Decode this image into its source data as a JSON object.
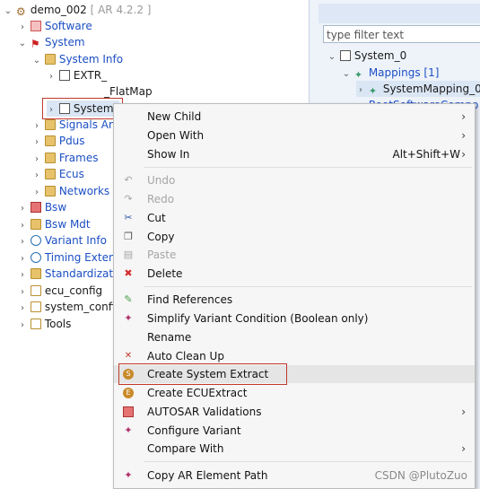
{
  "tree": {
    "root_label": "demo_002",
    "root_version": "[ AR 4.2.2 ]",
    "software": "Software",
    "system": "System",
    "system_info": "System Info",
    "extr": "EXTR_",
    "flatmap": "_FlatMap",
    "system_sel": "System_",
    "signals": "Signals An",
    "pdus": "Pdus",
    "frames": "Frames",
    "ecus": "Ecus",
    "networks": "Networks",
    "bsw": "Bsw",
    "bsw_mdt": "Bsw Mdt",
    "variant_info": "Variant Info",
    "timing": "Timing Exten",
    "standardization": "Standardizati",
    "ecu_config": "ecu_config",
    "system_config": "system_confi",
    "tools": "Tools"
  },
  "right_panel": {
    "filter_placeholder": "type filter text",
    "system0": "System_0",
    "mappings": "Mappings [1]",
    "system_mapping": "SystemMapping_0",
    "root_software": "RootSoftwareCompo"
  },
  "context_menu": {
    "new_child": "New Child",
    "open_with": "Open With",
    "show_in": "Show In",
    "show_in_shortcut": "Alt+Shift+W",
    "undo": "Undo",
    "redo": "Redo",
    "cut": "Cut",
    "copy": "Copy",
    "paste": "Paste",
    "delete": "Delete",
    "find_references": "Find References",
    "simplify": "Simplify Variant Condition (Boolean only)",
    "rename": "Rename",
    "auto_clean": "Auto Clean Up",
    "create_system_extract": "Create System Extract",
    "create_ecuextract": "Create ECUExtract",
    "autosar_validations": "AUTOSAR Validations",
    "configure_variant": "Configure Variant",
    "compare_with": "Compare With",
    "copy_path": "Copy AR Element Path"
  },
  "colors": {
    "accent_blue": "#1c4fc4",
    "highlight_red": "#c0392b"
  },
  "watermark": "CSDN @PlutoZuo"
}
